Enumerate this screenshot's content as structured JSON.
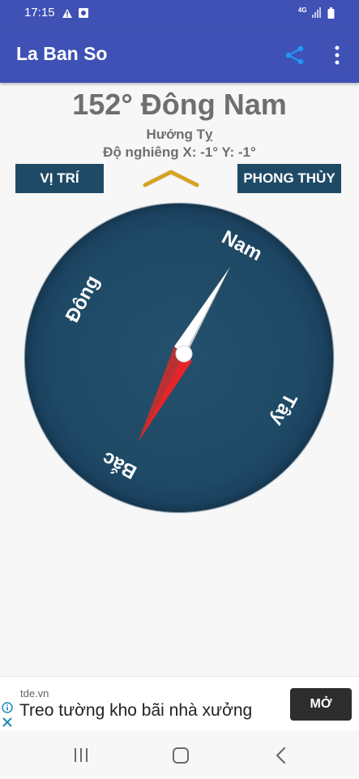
{
  "status_bar": {
    "time": "17:15",
    "network": "4G"
  },
  "app_bar": {
    "title": "La Ban So",
    "icons": [
      "share-icon",
      "more-vert-icon"
    ]
  },
  "compass_info": {
    "heading_text": "152° Đông Nam",
    "direction_text": "Hướng Tỵ",
    "tilt_text": "Độ nghiêng X: -1° Y: -1°",
    "heading_degrees": 152
  },
  "buttons": {
    "location_label": "VỊ TRÍ",
    "fengshui_label": "PHONG THỦY"
  },
  "compass_dial": {
    "labels": {
      "south": "Nam",
      "east": "Đông",
      "west": "Tây",
      "north": "Bắc"
    },
    "face_color": "#1f4a66",
    "needle_north_color": "#e52529",
    "needle_south_color": "#f2f2f2"
  },
  "ad": {
    "domain": "tde.vn",
    "text": "Treo tường kho bãi nhà xưởng",
    "cta": "MỞ"
  },
  "colors": {
    "primary": "#3f51b5",
    "accent": "#2196f3",
    "indicator": "#d4a429"
  }
}
